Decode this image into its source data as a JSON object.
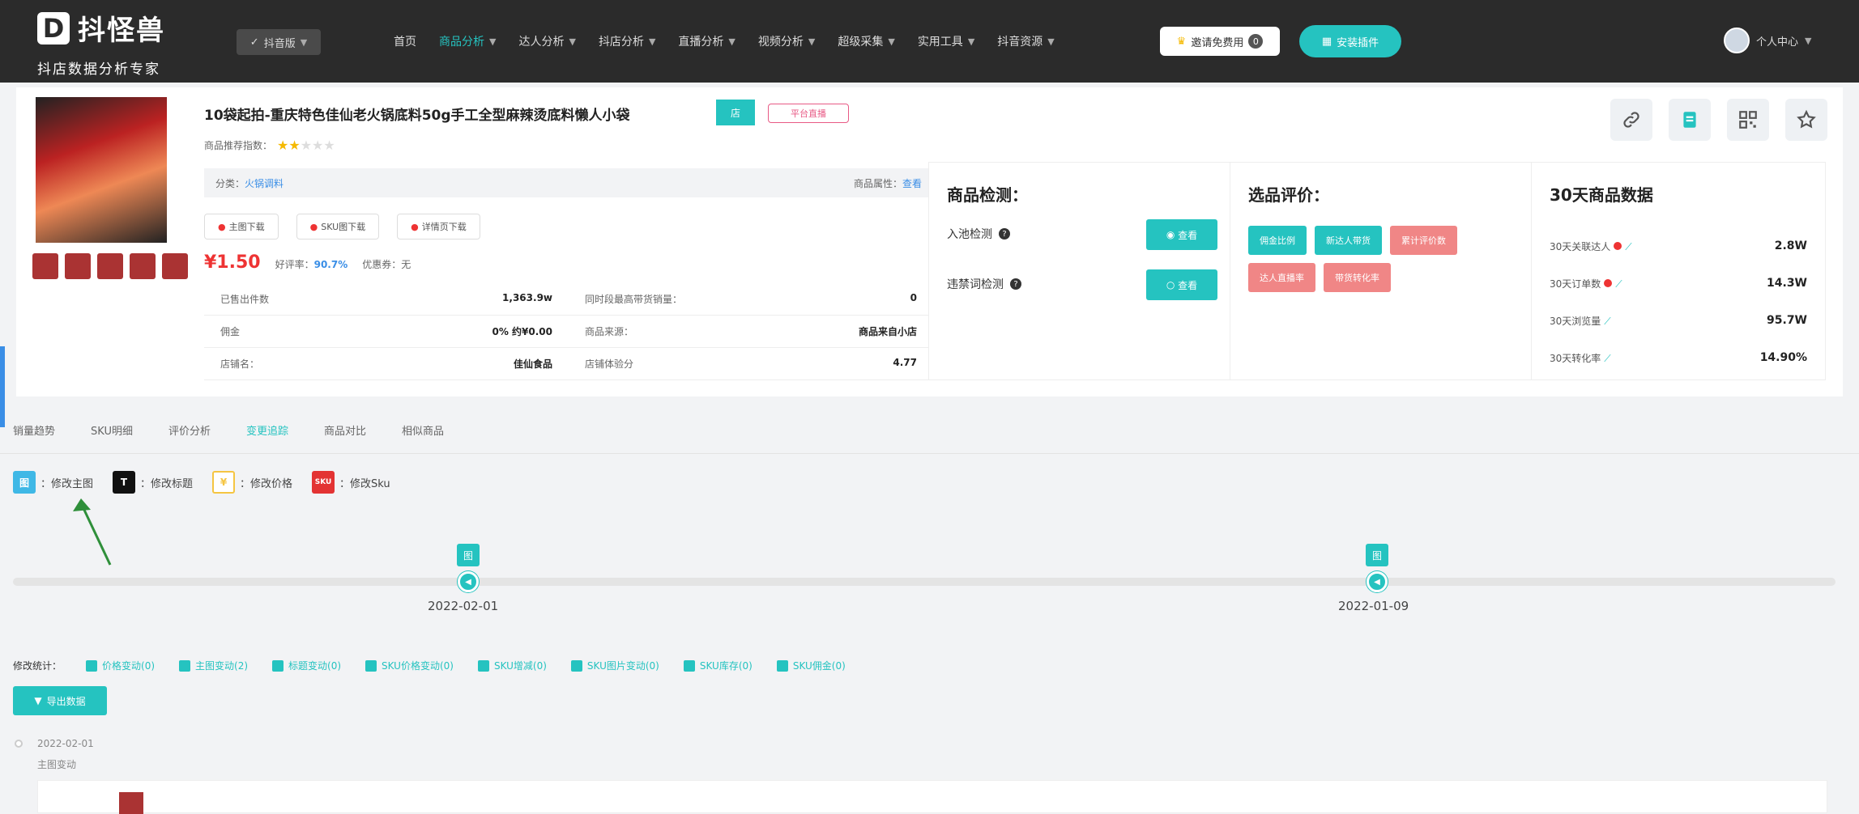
{
  "brand": {
    "name": "抖怪兽",
    "tagline": "抖店数据分析专家",
    "logo_letter": "D"
  },
  "header": {
    "version_label": "抖音版",
    "nav": [
      {
        "label": "首页",
        "dropdown": false,
        "active": false
      },
      {
        "label": "商品分析",
        "dropdown": true,
        "active": true
      },
      {
        "label": "达人分析",
        "dropdown": true,
        "active": false
      },
      {
        "label": "抖店分析",
        "dropdown": true,
        "active": false
      },
      {
        "label": "直播分析",
        "dropdown": true,
        "active": false
      },
      {
        "label": "视频分析",
        "dropdown": true,
        "active": false
      },
      {
        "label": "超级采集",
        "dropdown": true,
        "active": false
      },
      {
        "label": "实用工具",
        "dropdown": true,
        "active": false
      },
      {
        "label": "抖音资源",
        "dropdown": true,
        "active": false
      }
    ],
    "vip_button": "邀请免费用",
    "vip_badge": "0",
    "cta_button": "安装插件",
    "user_label": "个人中心"
  },
  "product": {
    "title": "10袋起拍-重庆特色佳仙老火锅底料50g手工全型麻辣烫底料懒人小袋",
    "tag_cyan": "店",
    "tag_pink": "平台直播",
    "rating_label": "商品推荐指数：",
    "rating_stars": 2,
    "rating_max": 5,
    "category_label": "分类：",
    "category_value": "火锅调料",
    "attr_label": "商品属性：",
    "attr_value": "查看",
    "downloads": [
      "主图下载",
      "SKU图下载",
      "详情页下载"
    ],
    "price": "¥1.50",
    "good_rate_label": "好评率：",
    "good_rate": "90.7%",
    "coupon_label": "优惠券：无",
    "stats": [
      [
        {
          "label": "已售出件数",
          "value": "1,363.9w"
        },
        {
          "label": "同时段最高带货销量：",
          "value": "0"
        }
      ],
      [
        {
          "label": "佣金",
          "value": "0% 约¥0.00"
        },
        {
          "label": "商品来源：",
          "value": "商品来自小店"
        }
      ],
      [
        {
          "label": "店铺名：",
          "value": "佳仙食品"
        },
        {
          "label": "店铺体验分",
          "value": "4.77"
        }
      ]
    ]
  },
  "panels": {
    "detect": {
      "title": "商品检测：",
      "rows": [
        {
          "label": "入池检测",
          "button": "查看"
        },
        {
          "label": "违禁词检测",
          "button": "查看"
        }
      ]
    },
    "evaluate": {
      "title": "选品评价：",
      "tags": [
        {
          "text": "佣金比例",
          "color": "c"
        },
        {
          "text": "新达人带货",
          "color": "c"
        },
        {
          "text": "累计评价数",
          "color": "r"
        },
        {
          "text": "达人直播率",
          "color": "r"
        },
        {
          "text": "带货转化率",
          "color": "r"
        }
      ]
    },
    "data30": {
      "title": "30天商品数据",
      "rows": [
        {
          "label": "30天关联达人",
          "value": "2.8W",
          "dot": true
        },
        {
          "label": "30天订单数",
          "value": "14.3W",
          "dot": true
        },
        {
          "label": "30天浏览量",
          "value": "95.7W",
          "dot": false
        },
        {
          "label": "30天转化率",
          "value": "14.90%",
          "dot": false
        }
      ]
    }
  },
  "tabs": [
    {
      "label": "销量趋势",
      "active": false
    },
    {
      "label": "SKU明细",
      "active": false
    },
    {
      "label": "评价分析",
      "active": false
    },
    {
      "label": "变更追踪",
      "active": true
    },
    {
      "label": "商品对比",
      "active": false
    },
    {
      "label": "相似商品",
      "active": false
    }
  ],
  "legend": [
    {
      "symbol": "图",
      "label": "：修改主图",
      "color": "#3fb8e6"
    },
    {
      "symbol": "T",
      "label": "：修改标题",
      "color": "#111111"
    },
    {
      "symbol": "¥",
      "label": "：修改价格",
      "color": "#f5c542"
    },
    {
      "symbol": "SKU",
      "label": "：修改Sku",
      "color": "#e33333"
    }
  ],
  "timeline": [
    {
      "date": "2022-02-01",
      "icon": "图"
    },
    {
      "date": "2022-01-09",
      "icon": "图"
    }
  ],
  "modifications": {
    "label": "修改统计：",
    "items": [
      "价格变动(0)",
      "主图变动(2)",
      "标题变动(0)",
      "SKU价格变动(0)",
      "SKU增减(0)",
      "SKU图片变动(0)",
      "SKU库存(0)",
      "SKU佣金(0)"
    ]
  },
  "export_button": "导出数据",
  "log": {
    "date": "2022-02-01",
    "type": "主图变动"
  }
}
